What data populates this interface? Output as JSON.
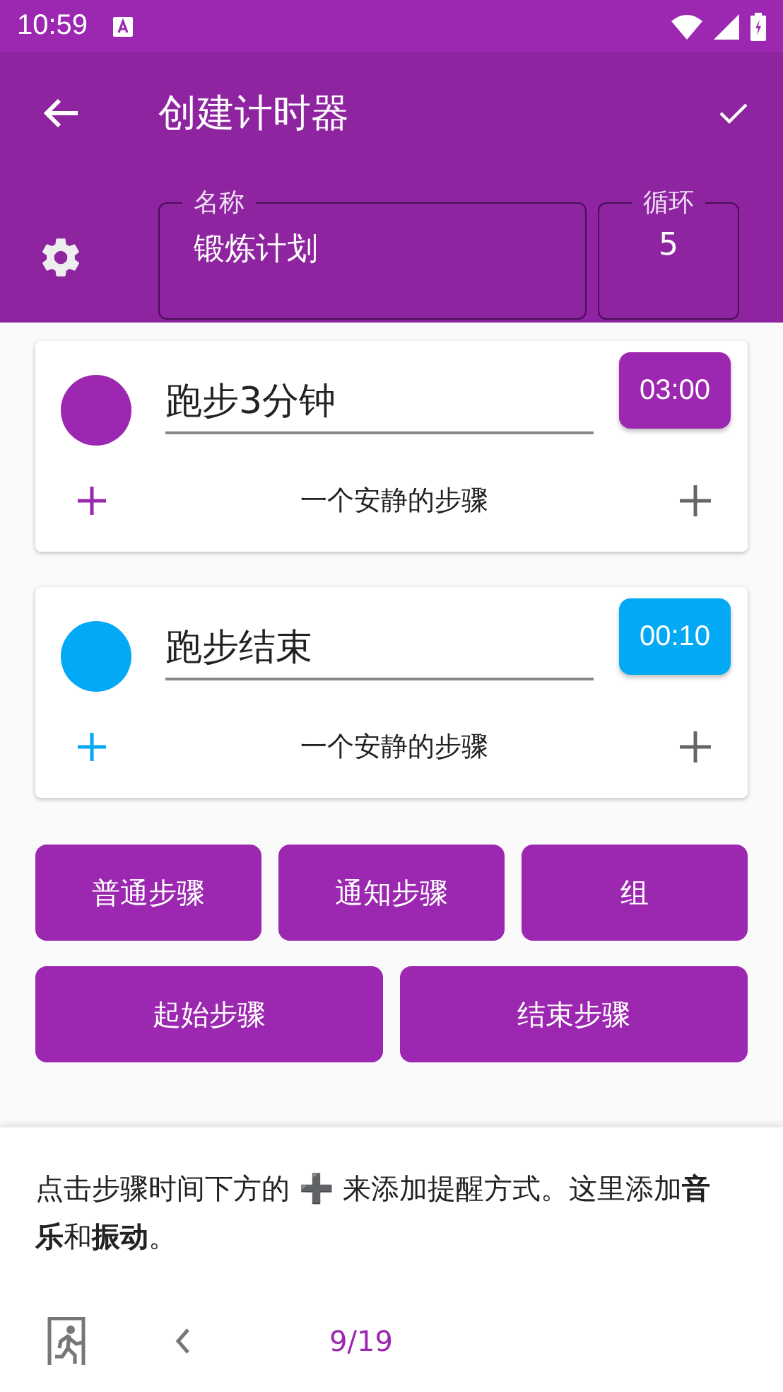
{
  "status_bar": {
    "time": "10:59"
  },
  "app_bar": {
    "title": "创建计时器",
    "name_field": {
      "label": "名称",
      "value": "锻炼计划"
    },
    "loop_field": {
      "label": "循环",
      "value": "5"
    }
  },
  "steps": [
    {
      "name": "跑步3分钟",
      "duration": "03:00",
      "color": "#9c27b0",
      "sound": "一个安静的步骤"
    },
    {
      "name": "跑步结束",
      "duration": "00:10",
      "color": "#03a9f4",
      "sound": "一个安静的步骤"
    }
  ],
  "add_buttons": [
    [
      "普通步骤",
      "通知步骤",
      "组"
    ],
    [
      "起始步骤",
      "结束步骤"
    ]
  ],
  "tutorial": {
    "text": "点击步骤时间下方的 ➕ 来添加提醒方式。这里添加**音乐**和**振动**。",
    "page": "9/19"
  }
}
